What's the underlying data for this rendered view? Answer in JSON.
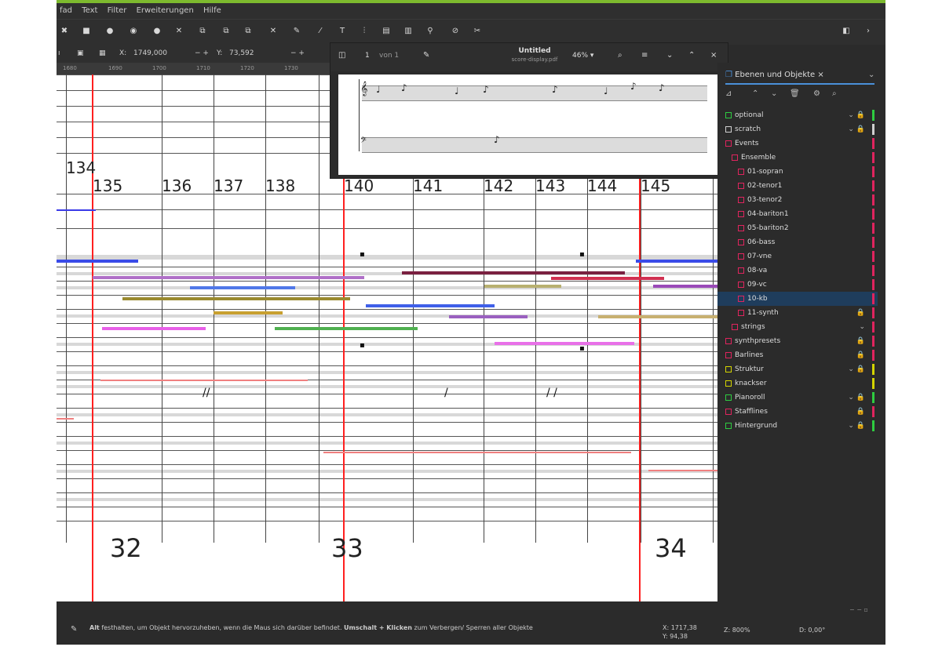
{
  "menu": [
    "fad",
    "Text",
    "Filter",
    "Erweiterungen",
    "Hilfe"
  ],
  "ctrl": {
    "x_label": "X:",
    "x_value": "1749,000",
    "y_label": "Y:",
    "y_value": "73,592"
  },
  "ruler_ticks": [
    "1680",
    "1690",
    "1700",
    "1710",
    "1720",
    "1730"
  ],
  "popup": {
    "page_label": "1",
    "page_of": "von 1",
    "title": "Untitled",
    "subtitle": "score-display.pdf",
    "zoom": "46% ▾"
  },
  "measures": [
    "134",
    "135",
    "136",
    "137",
    "138",
    "140",
    "141",
    "142",
    "143",
    "144",
    "145"
  ],
  "big_numbers": [
    "32",
    "33",
    "34"
  ],
  "sidebar": {
    "tab_label": "Ebenen und Objekte ×",
    "layers": [
      {
        "name": "optional",
        "color": "#2ecc40",
        "icons": "⌄ 🔒"
      },
      {
        "name": "scratch",
        "color": "#d0d0d0",
        "icons": "⌄ 🔒"
      },
      {
        "name": "Events",
        "color": "#e0245e",
        "icons": ""
      },
      {
        "name": "Ensemble",
        "color": "#e0245e",
        "icons": ""
      },
      {
        "name": "01-sopran",
        "color": "#e0245e",
        "icons": ""
      },
      {
        "name": "02-tenor1",
        "color": "#e0245e",
        "icons": ""
      },
      {
        "name": "03-tenor2",
        "color": "#e0245e",
        "icons": ""
      },
      {
        "name": "04-bariton1",
        "color": "#e0245e",
        "icons": ""
      },
      {
        "name": "05-bariton2",
        "color": "#e0245e",
        "icons": ""
      },
      {
        "name": "06-bass",
        "color": "#e0245e",
        "icons": ""
      },
      {
        "name": "07-vne",
        "color": "#e0245e",
        "icons": ""
      },
      {
        "name": "08-va",
        "color": "#e0245e",
        "icons": ""
      },
      {
        "name": "09-vc",
        "color": "#e0245e",
        "icons": ""
      },
      {
        "name": "10-kb",
        "color": "#e0245e",
        "icons": ""
      },
      {
        "name": "11-synth",
        "color": "#e0245e",
        "icons": "🔒"
      },
      {
        "name": "strings",
        "color": "#e0245e",
        "icons": "⌄"
      },
      {
        "name": "synthpresets",
        "color": "#e0245e",
        "icons": "🔒"
      },
      {
        "name": "Barlines",
        "color": "#e0245e",
        "icons": "🔒"
      },
      {
        "name": "Struktur",
        "color": "#d4d400",
        "icons": "⌄ 🔒"
      },
      {
        "name": "knackser",
        "color": "#d4d400",
        "icons": ""
      },
      {
        "name": "Pianoroll",
        "color": "#2ecc40",
        "icons": "⌄ 🔒"
      },
      {
        "name": "Stafflines",
        "color": "#e0245e",
        "icons": "🔒"
      },
      {
        "name": "Hintergrund",
        "color": "#2ecc40",
        "icons": "⌄ 🔒"
      }
    ]
  },
  "status": {
    "message_bold1": "Alt",
    "message_part1": "festhalten, um Objekt hervorzuheben, wenn die Maus sich darüber befindet.",
    "message_bold2": "Umschalt + Klicken",
    "message_part2": "zum Verbergen/ Sperren aller Objekte",
    "coord_x": "X: 1717,38",
    "coord_y": "Y: 94,38",
    "zoom": "Z: 800%",
    "rotation": "D: 0,00°"
  },
  "colors": {
    "accent": "#7dba2e",
    "selection": "#1f3d5c",
    "redline": "#ff2020"
  }
}
